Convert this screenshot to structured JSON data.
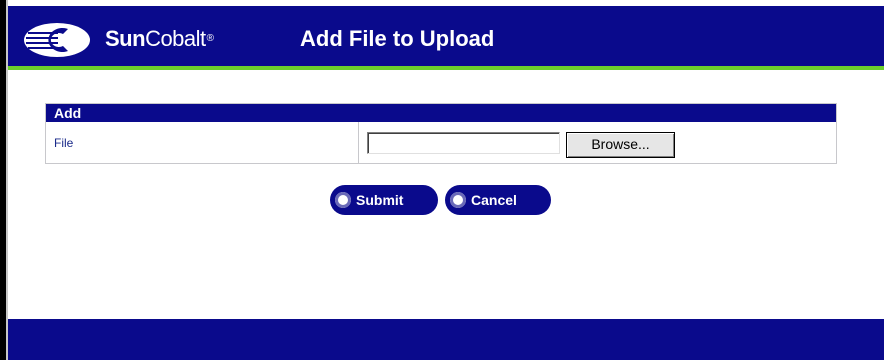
{
  "header": {
    "brand_bold": "Sun",
    "brand_regular": "Cobalt",
    "brand_tm": "®",
    "title": "Add File to Upload"
  },
  "form": {
    "section_title": "Add",
    "file_label": "File",
    "file_value": "",
    "browse_label": "Browse..."
  },
  "actions": {
    "submit_label": "Submit",
    "cancel_label": "Cancel"
  },
  "colors": {
    "primary_navy": "#0a0a8c",
    "accent_green": "#6ccf2c",
    "label_blue": "#1a2a8a"
  }
}
